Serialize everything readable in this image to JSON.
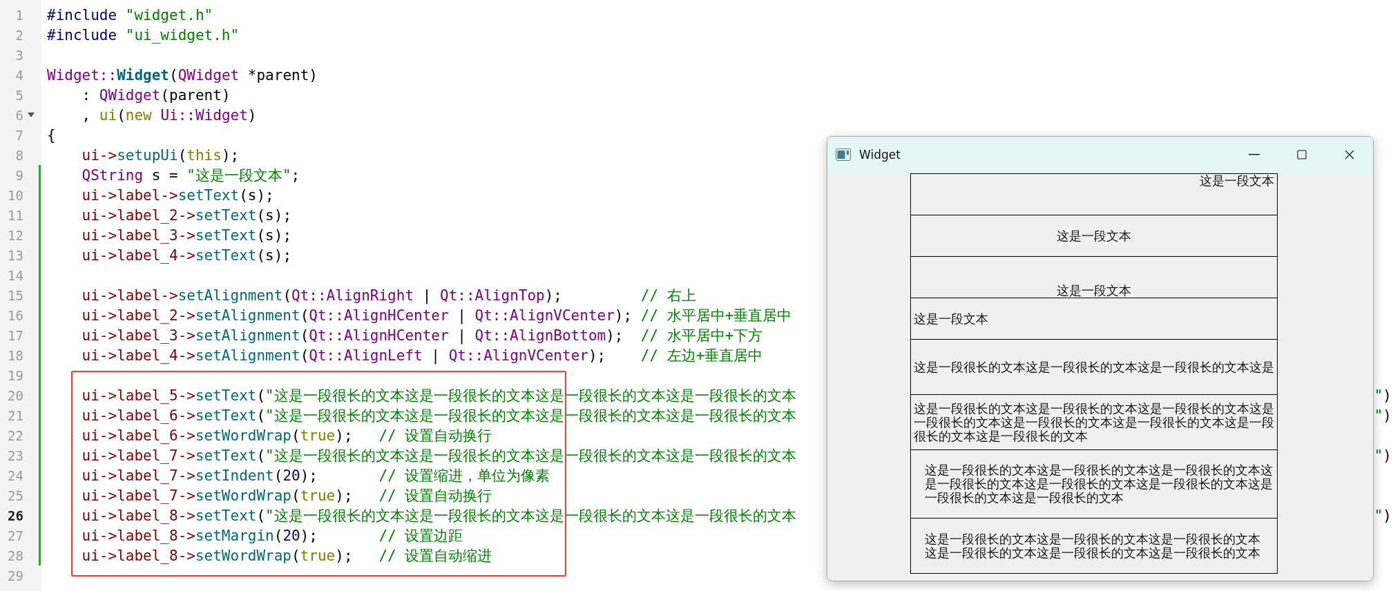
{
  "editor": {
    "lines": [
      {
        "number": "1",
        "current": false,
        "modified": false,
        "fold": false,
        "tokens": [
          {
            "text": "#include ",
            "kind": "directive"
          },
          {
            "text": "\"widget.h\"",
            "kind": "string"
          }
        ]
      },
      {
        "number": "2",
        "current": false,
        "modified": false,
        "fold": false,
        "tokens": [
          {
            "text": "#include ",
            "kind": "directive"
          },
          {
            "text": "\"ui_widget.h\"",
            "kind": "string"
          }
        ]
      },
      {
        "number": "3",
        "current": false,
        "modified": false,
        "fold": false
      },
      {
        "number": "4",
        "current": false,
        "modified": false,
        "fold": false,
        "tokens": [
          {
            "text": "Widget::",
            "kind": "type"
          },
          {
            "text": "Widget",
            "kind": "definition"
          },
          {
            "text": "(",
            "kind": "plain"
          },
          {
            "text": "QWidget",
            "kind": "type"
          },
          {
            "text": " *parent)",
            "kind": "plain"
          }
        ]
      },
      {
        "number": "5",
        "current": false,
        "modified": false,
        "fold": false,
        "tokens": [
          {
            "text": "    : ",
            "kind": "plain"
          },
          {
            "text": "QWidget",
            "kind": "type"
          },
          {
            "text": "(parent)",
            "kind": "plain"
          }
        ]
      },
      {
        "number": "6",
        "current": false,
        "modified": false,
        "fold": true,
        "tokens": [
          {
            "text": "    , ",
            "kind": "plain"
          },
          {
            "text": "ui",
            "kind": "keyword"
          },
          {
            "text": "(",
            "kind": "plain"
          },
          {
            "text": "new",
            "kind": "keyword"
          },
          {
            "text": " Ui::Widget",
            "kind": "type"
          },
          {
            "text": ")",
            "kind": "plain"
          }
        ]
      },
      {
        "number": "7",
        "current": false,
        "modified": false,
        "fold": false,
        "tokens": [
          {
            "text": "{",
            "kind": "plain"
          }
        ]
      },
      {
        "number": "8",
        "current": false,
        "modified": false,
        "fold": false,
        "tokens": [
          {
            "text": "    ui->",
            "kind": "member"
          },
          {
            "text": "setupUi",
            "kind": "function"
          },
          {
            "text": "(",
            "kind": "plain"
          },
          {
            "text": "this",
            "kind": "keyword"
          },
          {
            "text": ");",
            "kind": "plain"
          }
        ]
      },
      {
        "number": "9",
        "current": false,
        "modified": true,
        "fold": false,
        "tokens": [
          {
            "text": "    QString",
            "kind": "type"
          },
          {
            "text": " s = ",
            "kind": "plain"
          },
          {
            "text": "\"这是一段文本\"",
            "kind": "string"
          },
          {
            "text": ";",
            "kind": "plain"
          }
        ]
      },
      {
        "number": "10",
        "current": false,
        "modified": true,
        "fold": false,
        "tokens": [
          {
            "text": "    ui->label->",
            "kind": "member"
          },
          {
            "text": "setText",
            "kind": "function"
          },
          {
            "text": "(s);",
            "kind": "plain"
          }
        ]
      },
      {
        "number": "11",
        "current": false,
        "modified": true,
        "fold": false,
        "tokens": [
          {
            "text": "    ui->label_2->",
            "kind": "member"
          },
          {
            "text": "setText",
            "kind": "function"
          },
          {
            "text": "(s);",
            "kind": "plain"
          }
        ]
      },
      {
        "number": "12",
        "current": false,
        "modified": true,
        "fold": false,
        "tokens": [
          {
            "text": "    ui->label_3->",
            "kind": "member"
          },
          {
            "text": "setText",
            "kind": "function"
          },
          {
            "text": "(s);",
            "kind": "plain"
          }
        ]
      },
      {
        "number": "13",
        "current": false,
        "modified": true,
        "fold": false,
        "tokens": [
          {
            "text": "    ui->label_4->",
            "kind": "member"
          },
          {
            "text": "setText",
            "kind": "function"
          },
          {
            "text": "(s);",
            "kind": "plain"
          }
        ]
      },
      {
        "number": "14",
        "current": false,
        "modified": true,
        "fold": false
      },
      {
        "number": "15",
        "current": false,
        "modified": true,
        "fold": false,
        "tokens": [
          {
            "text": "    ui->label->",
            "kind": "member"
          },
          {
            "text": "setAlignment",
            "kind": "function"
          },
          {
            "text": "(",
            "kind": "plain"
          },
          {
            "text": "Qt::AlignRight",
            "kind": "enum"
          },
          {
            "text": " | ",
            "kind": "plain"
          },
          {
            "text": "Qt::AlignTop",
            "kind": "enum"
          },
          {
            "text": ");         ",
            "kind": "plain"
          },
          {
            "text": "// 右上",
            "kind": "comment"
          }
        ]
      },
      {
        "number": "16",
        "current": false,
        "modified": true,
        "fold": false,
        "tokens": [
          {
            "text": "    ui->label_2->",
            "kind": "member"
          },
          {
            "text": "setAlignment",
            "kind": "function"
          },
          {
            "text": "(",
            "kind": "plain"
          },
          {
            "text": "Qt::AlignHCenter",
            "kind": "enum"
          },
          {
            "text": " | ",
            "kind": "plain"
          },
          {
            "text": "Qt::AlignVCenter",
            "kind": "enum"
          },
          {
            "text": "); ",
            "kind": "plain"
          },
          {
            "text": "// 水平居中+垂直居中",
            "kind": "comment"
          }
        ]
      },
      {
        "number": "17",
        "current": false,
        "modified": true,
        "fold": false,
        "tokens": [
          {
            "text": "    ui->label_3->",
            "kind": "member"
          },
          {
            "text": "setAlignment",
            "kind": "function"
          },
          {
            "text": "(",
            "kind": "plain"
          },
          {
            "text": "Qt::AlignHCenter",
            "kind": "enum"
          },
          {
            "text": " | ",
            "kind": "plain"
          },
          {
            "text": "Qt::AlignBottom",
            "kind": "enum"
          },
          {
            "text": ");  ",
            "kind": "plain"
          },
          {
            "text": "// 水平居中+下方",
            "kind": "comment"
          }
        ]
      },
      {
        "number": "18",
        "current": false,
        "modified": true,
        "fold": false,
        "tokens": [
          {
            "text": "    ui->label_4->",
            "kind": "member"
          },
          {
            "text": "setAlignment",
            "kind": "function"
          },
          {
            "text": "(",
            "kind": "plain"
          },
          {
            "text": "Qt::AlignLeft",
            "kind": "enum"
          },
          {
            "text": " | ",
            "kind": "plain"
          },
          {
            "text": "Qt::AlignVCenter",
            "kind": "enum"
          },
          {
            "text": ");    ",
            "kind": "plain"
          },
          {
            "text": "// 左边+垂直居中",
            "kind": "comment"
          }
        ]
      },
      {
        "number": "19",
        "current": false,
        "modified": true,
        "fold": false
      },
      {
        "number": "20",
        "current": false,
        "modified": true,
        "fold": false,
        "tokens": [
          {
            "text": "    ui->label_5->",
            "kind": "member"
          },
          {
            "text": "setText",
            "kind": "function"
          },
          {
            "text": "(",
            "kind": "plain"
          },
          {
            "text": "\"这是一段很长的文本这是一段很长的文本这是一段很长的文本这是一段很长的文本",
            "kind": "string"
          }
        ],
        "tail": [
          {
            "text": "\"",
            "kind": "string"
          },
          {
            "text": ")",
            "kind": "plain"
          }
        ]
      },
      {
        "number": "21",
        "current": false,
        "modified": true,
        "fold": false,
        "tokens": [
          {
            "text": "    ui->label_6->",
            "kind": "member"
          },
          {
            "text": "setText",
            "kind": "function"
          },
          {
            "text": "(",
            "kind": "plain"
          },
          {
            "text": "\"这是一段很长的文本这是一段很长的文本这是一段很长的文本这是一段很长的文本",
            "kind": "string"
          }
        ],
        "tail": [
          {
            "text": "\"",
            "kind": "string"
          },
          {
            "text": ")",
            "kind": "plain"
          }
        ]
      },
      {
        "number": "22",
        "current": false,
        "modified": true,
        "fold": false,
        "tokens": [
          {
            "text": "    ui->label_6->",
            "kind": "member"
          },
          {
            "text": "setWordWrap",
            "kind": "function"
          },
          {
            "text": "(",
            "kind": "plain"
          },
          {
            "text": "true",
            "kind": "keyword"
          },
          {
            "text": ");   ",
            "kind": "plain"
          },
          {
            "text": "// 设置自动换行",
            "kind": "comment"
          }
        ]
      },
      {
        "number": "23",
        "current": false,
        "modified": true,
        "fold": false,
        "tokens": [
          {
            "text": "    ui->label_7->",
            "kind": "member"
          },
          {
            "text": "setText",
            "kind": "function"
          },
          {
            "text": "(",
            "kind": "plain"
          },
          {
            "text": "\"这是一段很长的文本这是一段很长的文本这是一段很长的文本这是一段很长的文本",
            "kind": "string"
          }
        ],
        "tail": [
          {
            "text": "\"",
            "kind": "string"
          },
          {
            "text": ")",
            "kind": "plain"
          }
        ]
      },
      {
        "number": "24",
        "current": false,
        "modified": true,
        "fold": false,
        "tokens": [
          {
            "text": "    ui->label_7->",
            "kind": "member"
          },
          {
            "text": "setIndent",
            "kind": "function"
          },
          {
            "text": "(",
            "kind": "plain"
          },
          {
            "text": "20",
            "kind": "number"
          },
          {
            "text": ");       ",
            "kind": "plain"
          },
          {
            "text": "// 设置缩进，单位为像素",
            "kind": "comment"
          }
        ]
      },
      {
        "number": "25",
        "current": false,
        "modified": true,
        "fold": false,
        "tokens": [
          {
            "text": "    ui->label_7->",
            "kind": "member"
          },
          {
            "text": "setWordWrap",
            "kind": "function"
          },
          {
            "text": "(",
            "kind": "plain"
          },
          {
            "text": "true",
            "kind": "keyword"
          },
          {
            "text": ");   ",
            "kind": "plain"
          },
          {
            "text": "// 设置自动换行",
            "kind": "comment"
          }
        ]
      },
      {
        "number": "26",
        "current": true,
        "modified": true,
        "fold": false,
        "tokens": [
          {
            "text": "    ui->label_8->",
            "kind": "member"
          },
          {
            "text": "setText",
            "kind": "function"
          },
          {
            "text": "(",
            "kind": "plain"
          },
          {
            "text": "\"这是一段很长的文本这是一段很长的文本这是一段很长的文本这是一段很长的文本",
            "kind": "string"
          }
        ],
        "tail": [
          {
            "text": "\"",
            "kind": "string"
          },
          {
            "text": ")",
            "kind": "plain"
          }
        ]
      },
      {
        "number": "27",
        "current": false,
        "modified": true,
        "fold": false,
        "tokens": [
          {
            "text": "    ui->label_8->",
            "kind": "member"
          },
          {
            "text": "setMargin",
            "kind": "function"
          },
          {
            "text": "(",
            "kind": "plain"
          },
          {
            "text": "20",
            "kind": "number"
          },
          {
            "text": ");       ",
            "kind": "plain"
          },
          {
            "text": "// 设置边距",
            "kind": "comment"
          }
        ]
      },
      {
        "number": "28",
        "current": false,
        "modified": true,
        "fold": false,
        "tokens": [
          {
            "text": "    ui->label_8->",
            "kind": "member"
          },
          {
            "text": "setWordWrap",
            "kind": "function"
          },
          {
            "text": "(",
            "kind": "plain"
          },
          {
            "text": "true",
            "kind": "keyword"
          },
          {
            "text": ");   ",
            "kind": "plain"
          },
          {
            "text": "// 设置自动缩进",
            "kind": "comment"
          }
        ]
      },
      {
        "number": "29",
        "current": false,
        "modified": false,
        "fold": false
      }
    ]
  },
  "window": {
    "title": "Widget",
    "labels": [
      {
        "text": "这是一段文本",
        "kind": "top-right"
      },
      {
        "text": "这是一段文本",
        "kind": "center"
      },
      {
        "text": "这是一段文本",
        "kind": "bottom-center"
      },
      {
        "text": "这是一段文本",
        "kind": "left-center"
      },
      {
        "text": "这是一段很长的文本这是一段很长的文本这是一段很长的文本这是",
        "kind": "single-line"
      },
      {
        "text": "这是一段很长的文本这是一段很长的文本这是一段很长的文本这是一段很长的文本这是一段很长的文本这是一段很长的文本这是一段很长的文本这是一段很长的文本",
        "kind": "wrap"
      },
      {
        "text": "这是一段很长的文本这是一段很长的文本这是一段很长的文本这是一段很长的文本这是一段很长的文本这是一段很长的文本这是一段很长的文本这是一段很长的文本",
        "kind": "indent"
      },
      {
        "text": "这是一段很长的文本这是一段很长的文本这是一段很长的文本这是一段很长的文本这是一段很长的文本这是一段很长的文本",
        "kind": "margin"
      }
    ]
  }
}
